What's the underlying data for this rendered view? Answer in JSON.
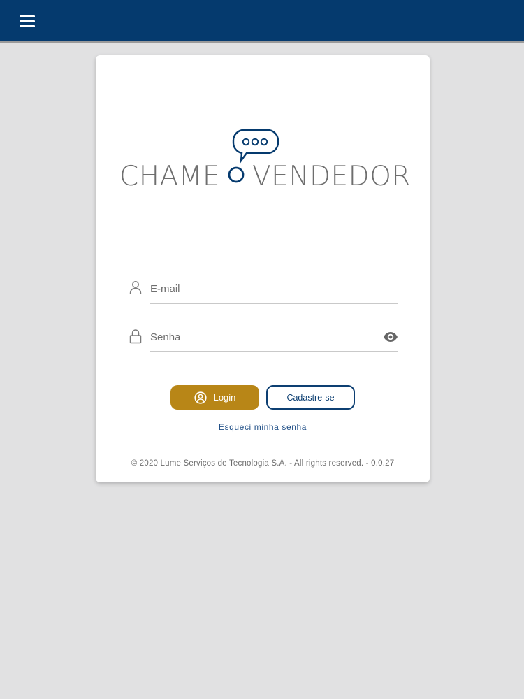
{
  "header": {
    "menu_icon": "hamburger-menu-icon",
    "background": "#053a6e"
  },
  "logo": {
    "word_left": "CHAME",
    "word_right": "VENDEDOR",
    "bubble_text": "ooo",
    "accent": "#053a6e"
  },
  "form": {
    "email": {
      "placeholder": "E-mail",
      "value": "",
      "icon": "user-icon"
    },
    "password": {
      "placeholder": "Senha",
      "value": "",
      "icon": "lock-icon",
      "toggle_icon": "eye-icon"
    }
  },
  "buttons": {
    "login_label": "Login",
    "login_icon": "user-circle-icon",
    "login_color": "#b88617",
    "signup_label": "Cadastre-se",
    "signup_color": "#0d3f72"
  },
  "links": {
    "forgot_password": "Esqueci minha senha"
  },
  "footer": {
    "text": "© 2020 Lume Serviços de Tecnologia S.A. - All rights reserved. - 0.0.27"
  }
}
